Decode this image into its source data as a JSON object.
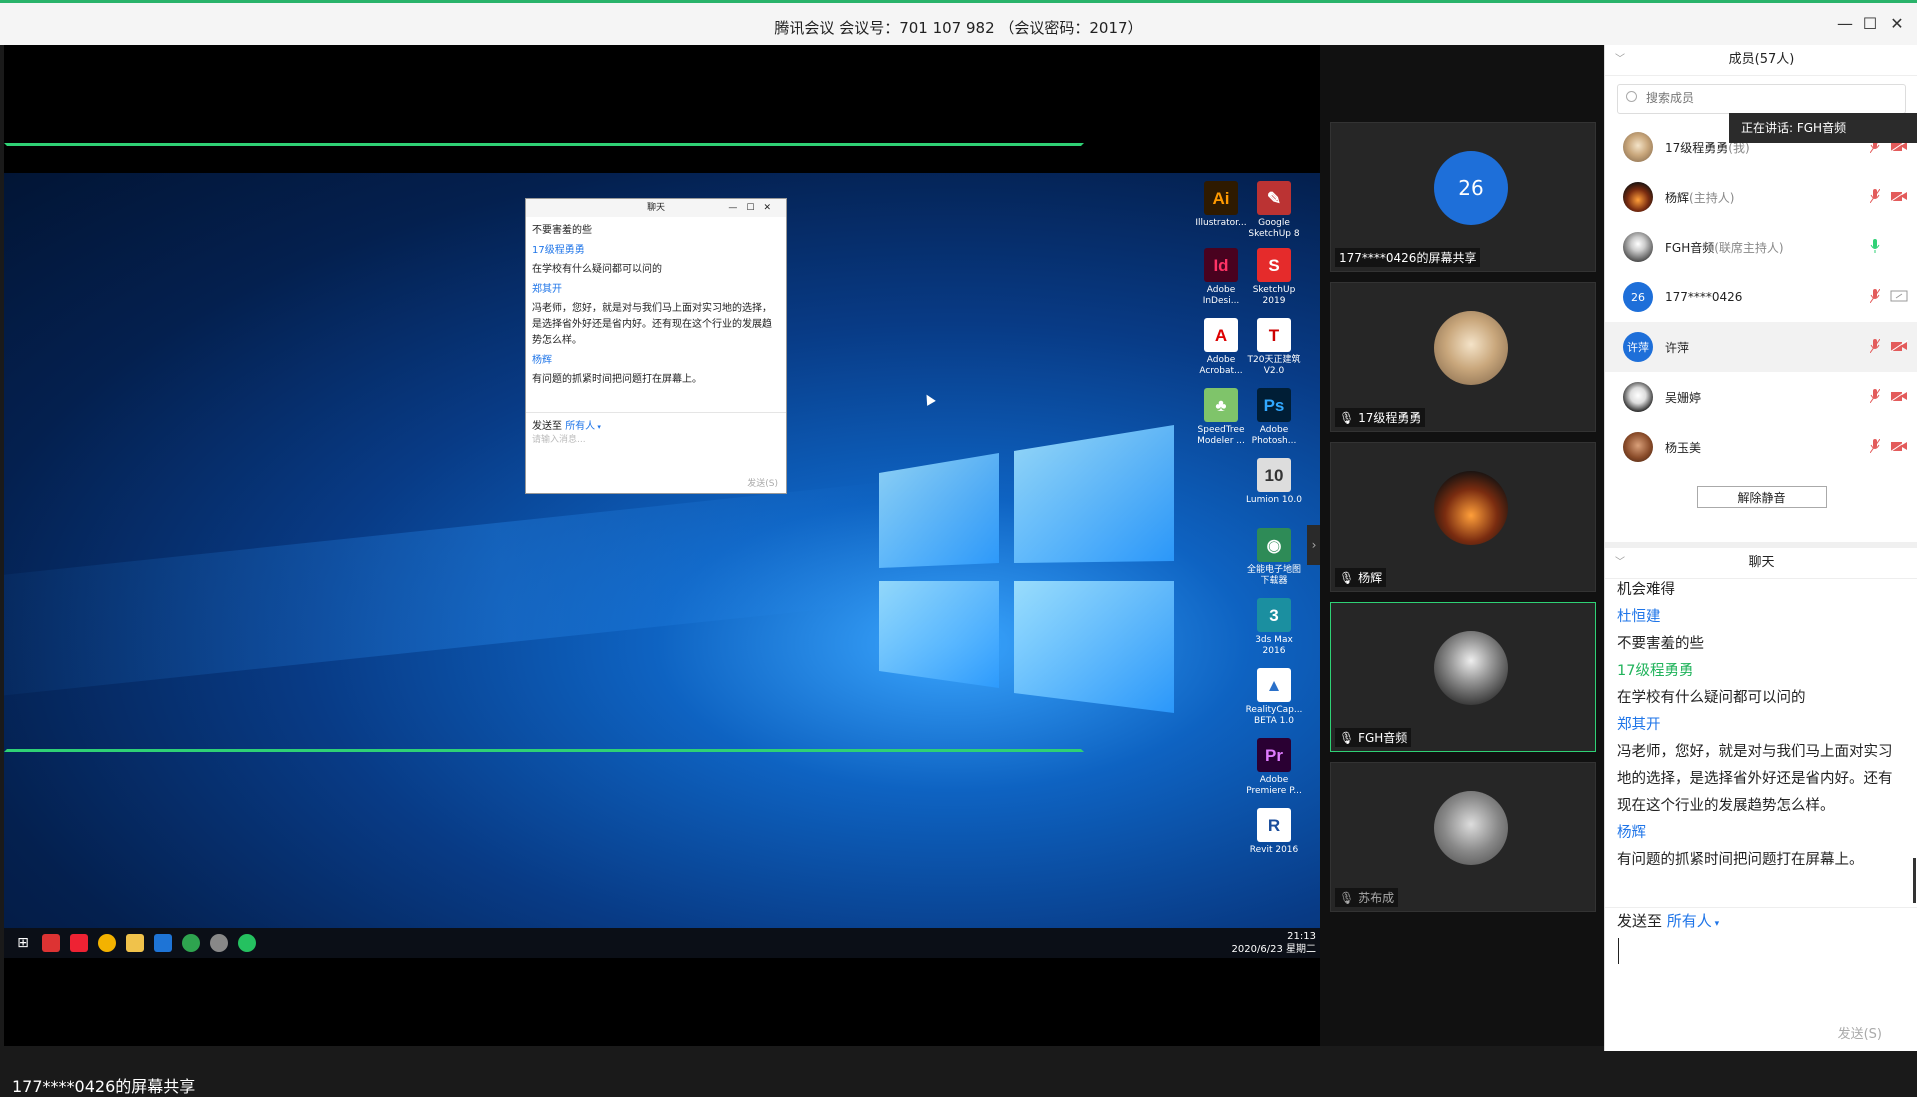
{
  "window": {
    "title": "腾讯会议 会议号：701 107 982 （会议密码：2017）"
  },
  "share": {
    "label": "177****0426的屏幕共享",
    "clock_time": "21:13",
    "clock_date": "2020/6/23 星期二"
  },
  "desktop_icons": [
    {
      "label": "Illustrator...",
      "glyph": "Ai",
      "color": "#2e1a00",
      "fg": "#ff9a00"
    },
    {
      "label": "Google SketchUp 8",
      "glyph": "✎",
      "color": "#b33",
      "fg": "#fff"
    },
    {
      "label": "Adobe InDesi...",
      "glyph": "Id",
      "color": "#49021f",
      "fg": "#ff3366"
    },
    {
      "label": "SketchUp 2019",
      "glyph": "S",
      "color": "#e52b2b",
      "fg": "#fff"
    },
    {
      "label": "Adobe Acrobat...",
      "glyph": "A",
      "color": "#fff",
      "fg": "#d00"
    },
    {
      "label": "T20天正建筑 V2.0",
      "glyph": "T",
      "color": "#fff",
      "fg": "#c00"
    },
    {
      "label": "SpeedTree Modeler ...",
      "glyph": "♣",
      "color": "#7fc46a",
      "fg": "#fff"
    },
    {
      "label": "Adobe Photosh...",
      "glyph": "Ps",
      "color": "#001e36",
      "fg": "#31a8ff"
    },
    {
      "label": "Lumion 10.0",
      "glyph": "10",
      "color": "#ddd",
      "fg": "#333"
    },
    {
      "label": "全能电子地图下载器",
      "glyph": "◉",
      "color": "#2e8b57",
      "fg": "#fff"
    },
    {
      "label": "3ds Max 2016",
      "glyph": "3",
      "color": "#1b8fa0",
      "fg": "#fff"
    },
    {
      "label": "RealityCap... BETA 1.0",
      "glyph": "▲",
      "color": "#fff",
      "fg": "#2a70c9"
    },
    {
      "label": "Adobe Premiere P...",
      "glyph": "Pr",
      "color": "#2a0033",
      "fg": "#e07bff"
    },
    {
      "label": "Revit 2016",
      "glyph": "R",
      "color": "#fff",
      "fg": "#1a4d9c"
    }
  ],
  "inner_chat": {
    "title": "聊天",
    "messages": [
      {
        "text": "不要害羞的些"
      },
      {
        "name": "17级程勇勇"
      },
      {
        "text": "在学校有什么疑问都可以问的"
      },
      {
        "name": "郑其开"
      },
      {
        "text": "冯老师，您好，就是对与我们马上面对实习地的选择，是选择省外好还是省内好。还有现在这个行业的发展趋势怎么样。"
      },
      {
        "name": "杨辉"
      },
      {
        "text": "有问题的抓紧时间把问题打在屏幕上。"
      }
    ],
    "send_to": "发送至",
    "send_to_target": "所有人",
    "placeholder": "请输入消息...",
    "send_button": "发送(S)"
  },
  "tiles": [
    {
      "caption": "177****0426的屏幕共享",
      "avatar_text": "26"
    },
    {
      "caption": "17级程勇勇"
    },
    {
      "caption": "杨辉"
    },
    {
      "caption": "FGH音频"
    },
    {
      "caption": "苏布成"
    }
  ],
  "members": {
    "header": "成员(57人)",
    "search_placeholder": "搜索成员",
    "speaking_tooltip": "正在讲话: FGH音频",
    "list": [
      {
        "name": "17级程勇勇",
        "role": "(我)",
        "avatar": "cat"
      },
      {
        "name": "杨辉",
        "role": "(主持人)",
        "avatar": "cake"
      },
      {
        "name": "FGH音频",
        "role": "(联席主持人)",
        "avatar": "person"
      },
      {
        "name": "177****0426",
        "role": "",
        "avatar_text": "26"
      },
      {
        "name": "许萍",
        "role": "",
        "avatar_text": "许萍"
      },
      {
        "name": "吴姗婷",
        "role": "",
        "avatar": "panda"
      },
      {
        "name": "杨玉美",
        "role": "",
        "avatar": "girl"
      }
    ],
    "unmute_button": "解除静音"
  },
  "chat": {
    "header": "聊天",
    "messages": [
      {
        "text": "机会难得"
      },
      {
        "name": "杜恒建",
        "color": "blue"
      },
      {
        "text": "不要害羞的些"
      },
      {
        "name": "17级程勇勇",
        "color": "green"
      },
      {
        "text": "在学校有什么疑问都可以问的"
      },
      {
        "name": "郑其开",
        "color": "blue"
      },
      {
        "text": "冯老师，您好，就是对与我们马上面对实习地的选择，是选择省外好还是省内好。还有现在这个行业的发展趋势怎么样。"
      },
      {
        "name": "杨辉",
        "color": "blue"
      },
      {
        "text": "有问题的抓紧时间把问题打在屏幕上。"
      }
    ],
    "send_to": "发送至",
    "send_to_target": "所有人",
    "send_button": "发送(S)"
  },
  "colors": {
    "accent_green": "#2fd175",
    "name_blue": "#1f75e8",
    "name_green": "#20b35b"
  }
}
